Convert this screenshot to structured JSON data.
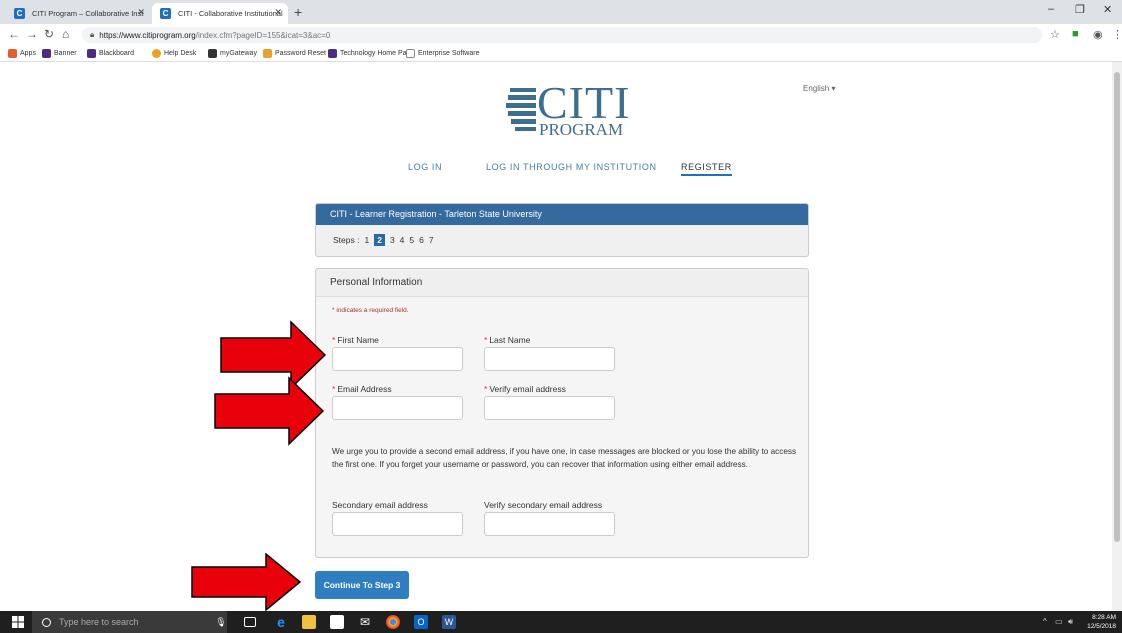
{
  "browser": {
    "tabs": [
      {
        "title": "CITI Program – Collaborative Inst",
        "favicon": "C"
      },
      {
        "title": "CITI - Collaborative Institutional",
        "favicon": "C"
      }
    ],
    "url_host": "https://www.citiprogram.org",
    "url_path": "/index.cfm?pageID=155&icat=3&ac=0",
    "bookmarks": [
      "Apps",
      "Banner",
      "Blackboard",
      "Help Desk",
      "myGateway",
      "Password Reset",
      "Technology Home Pa",
      "Enterprise Software"
    ]
  },
  "header": {
    "logo_text": "CITI",
    "logo_sub": "PROGRAM",
    "language": "English ▾"
  },
  "nav": {
    "login": "LOG IN",
    "login_institution": "LOG IN THROUGH MY INSTITUTION",
    "register": "REGISTER"
  },
  "registration": {
    "title": "CITI - Learner Registration - Tarleton State University",
    "steps_label": "Steps :",
    "steps": [
      "1",
      "2",
      "3",
      "4",
      "5",
      "6",
      "7"
    ],
    "current_step": "2"
  },
  "personal_info": {
    "title": "Personal Information",
    "required_note": "* indicates a required field.",
    "required_star": "*",
    "first_name_label": "First Name",
    "last_name_label": "Last Name",
    "email_label": "Email Address",
    "verify_email_label": "Verify email address",
    "urge_text": "We urge you to provide a second email address, if you have one, in case messages are blocked or you lose the ability to access the first one. If you forget your username or password, you can recover that information using either email address.",
    "secondary_email_label": "Secondary email address",
    "verify_secondary_label": "Verify secondary email address"
  },
  "continue_label": "Continue To Step 3",
  "taskbar": {
    "search_placeholder": "Type here to search",
    "time": "8:28 AM",
    "date": "12/5/2018"
  },
  "colors": {
    "accent": "#2f7ec2",
    "panel_header": "#356a9e",
    "arrow": "#e8000b"
  }
}
